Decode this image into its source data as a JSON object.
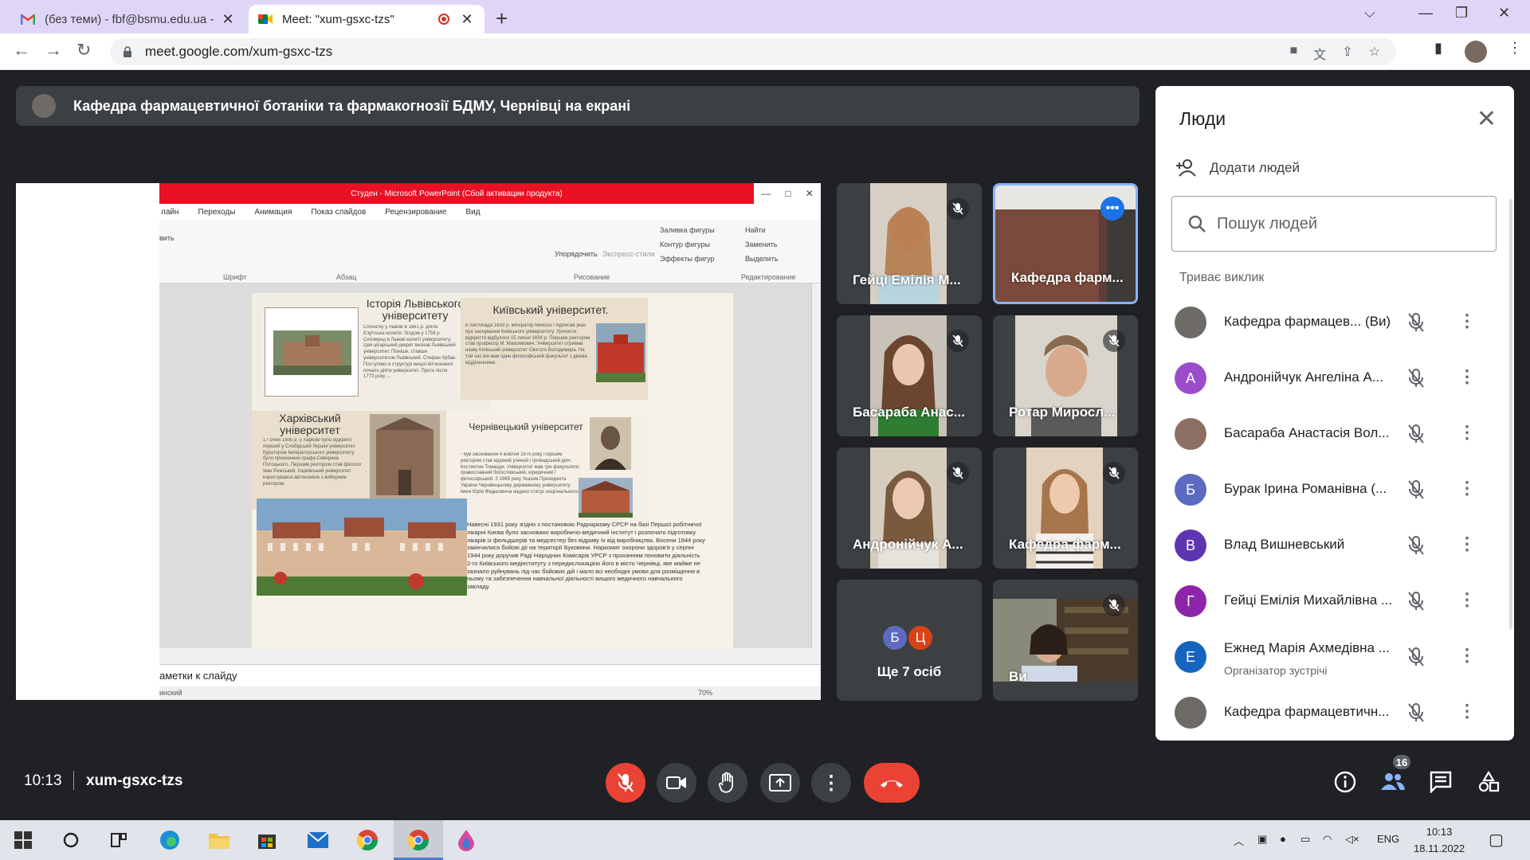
{
  "browser": {
    "tabs": [
      {
        "title": "(без теми) - fbf@bsmu.edu.ua - ",
        "close": "✕"
      },
      {
        "title": "Meet: \"xum-gsxc-tzs\"",
        "close": "✕"
      }
    ],
    "new_tab": "+",
    "url": "meet.google.com/xum-gsxc-tzs"
  },
  "meet": {
    "presenting_banner": "Кафедра фармацевтичної ботаніки та фармакогнозії БДМУ, Чернівці на екрані",
    "meeting_code": "xum-gsxc-tzs",
    "time": "10:13",
    "participants_count": "16",
    "tiles": [
      {
        "name": "Гейці Емілія М...",
        "muted": true
      },
      {
        "name": "Кафедра фарм...",
        "muted": false,
        "selected": true
      },
      {
        "name": "Басараба Анас...",
        "muted": true
      },
      {
        "name": "Ротар Миросл...",
        "muted": true
      },
      {
        "name": "Андронійчук А...",
        "muted": true
      },
      {
        "name": "Кафедра фарм...",
        "muted": true
      },
      {
        "name": "Ви",
        "muted": true
      }
    ],
    "others": {
      "label": "Ще 7 осіб",
      "avatars": [
        {
          "letter": "Б",
          "color": "#5c6bc0"
        },
        {
          "letter": "Ц",
          "color": "#d84315"
        }
      ]
    }
  },
  "slide": {
    "window_title": "Студен  -  Microsoft PowerPoint (Сбой активации продукта)",
    "menu": [
      "лайн",
      "Переходы",
      "Анимация",
      "Показ слайдов",
      "Рецензирование",
      "Вид"
    ],
    "ribbon_groups": [
      "Шрифт",
      "Абзац",
      "Рисование",
      "Редактирование"
    ],
    "ribbon_cmds": [
      "Найти",
      "Заменить",
      "Выделить",
      "Заливка фигуры",
      "Контур фигуры",
      "Эффекты фигур",
      "Упорядочить",
      "Экспресс-стили",
      "вить"
    ],
    "notes": "аметки к слайду",
    "status_left": "инский",
    "zoom": "70%",
    "headings": [
      "Історія Львівського університету",
      "Київський університет.",
      "Харківський університет",
      "Чернівецький університет"
    ],
    "body_snippet": "Навесні 1931 року згідно з постановою Раднаркому СРСР на базі Першої робітничої лікарні Києва було засновано виробничо-медичний інститут і розпочато підготовку лікарів із фельдшерів та медсестер без відриву їх від виробництва. Восени 1944 року закінчилися бойові дії на території Буковини. Наркомат охорони здоров'я у серпні 1944 року доручив Раді Народних Комісарів УРСР з проханням поновити діяльність 2-го Київського медінституту з передислокацією його в місто Чернівці, яке майже не зазнало руйнувань під час бойових дій і мало всі необхідні умови для розміщення в ньому та забезпечення навчальної діяльності вищого медичного навчального закладу."
  },
  "people_panel": {
    "title": "Люди",
    "add_people": "Додати людей",
    "search_placeholder": "Пошук людей",
    "section": "Триває виклик",
    "people": [
      {
        "name": "Кафедра фармацев... (Ви)",
        "sub": "",
        "letter": "",
        "color": "#6e6a66"
      },
      {
        "name": "Андронійчук Ангеліна А...",
        "sub": "",
        "letter": "А",
        "color": "#9c4dcc"
      },
      {
        "name": "Басараба Анастасія Вол...",
        "sub": "",
        "letter": "",
        "color": "#8d6e63"
      },
      {
        "name": "Бурак Ірина Романівна (...",
        "sub": "",
        "letter": "Б",
        "color": "#5c6bc0"
      },
      {
        "name": "Влад Вишневський",
        "sub": "",
        "letter": "В",
        "color": "#5e35b1"
      },
      {
        "name": "Гейці Емілія Михайлівна ...",
        "sub": "",
        "letter": "Г",
        "color": "#8e24aa"
      },
      {
        "name": "Ежнед Марія Ахмедівна ...",
        "sub": "Організатор зустрічі",
        "letter": "Е",
        "color": "#1565c0"
      },
      {
        "name": "Кафедра фармацевтичн...",
        "sub": "",
        "letter": "",
        "color": "#6e6a66"
      }
    ]
  },
  "taskbar": {
    "lang": "ENG",
    "time": "10:13",
    "date": "18.11.2022"
  }
}
